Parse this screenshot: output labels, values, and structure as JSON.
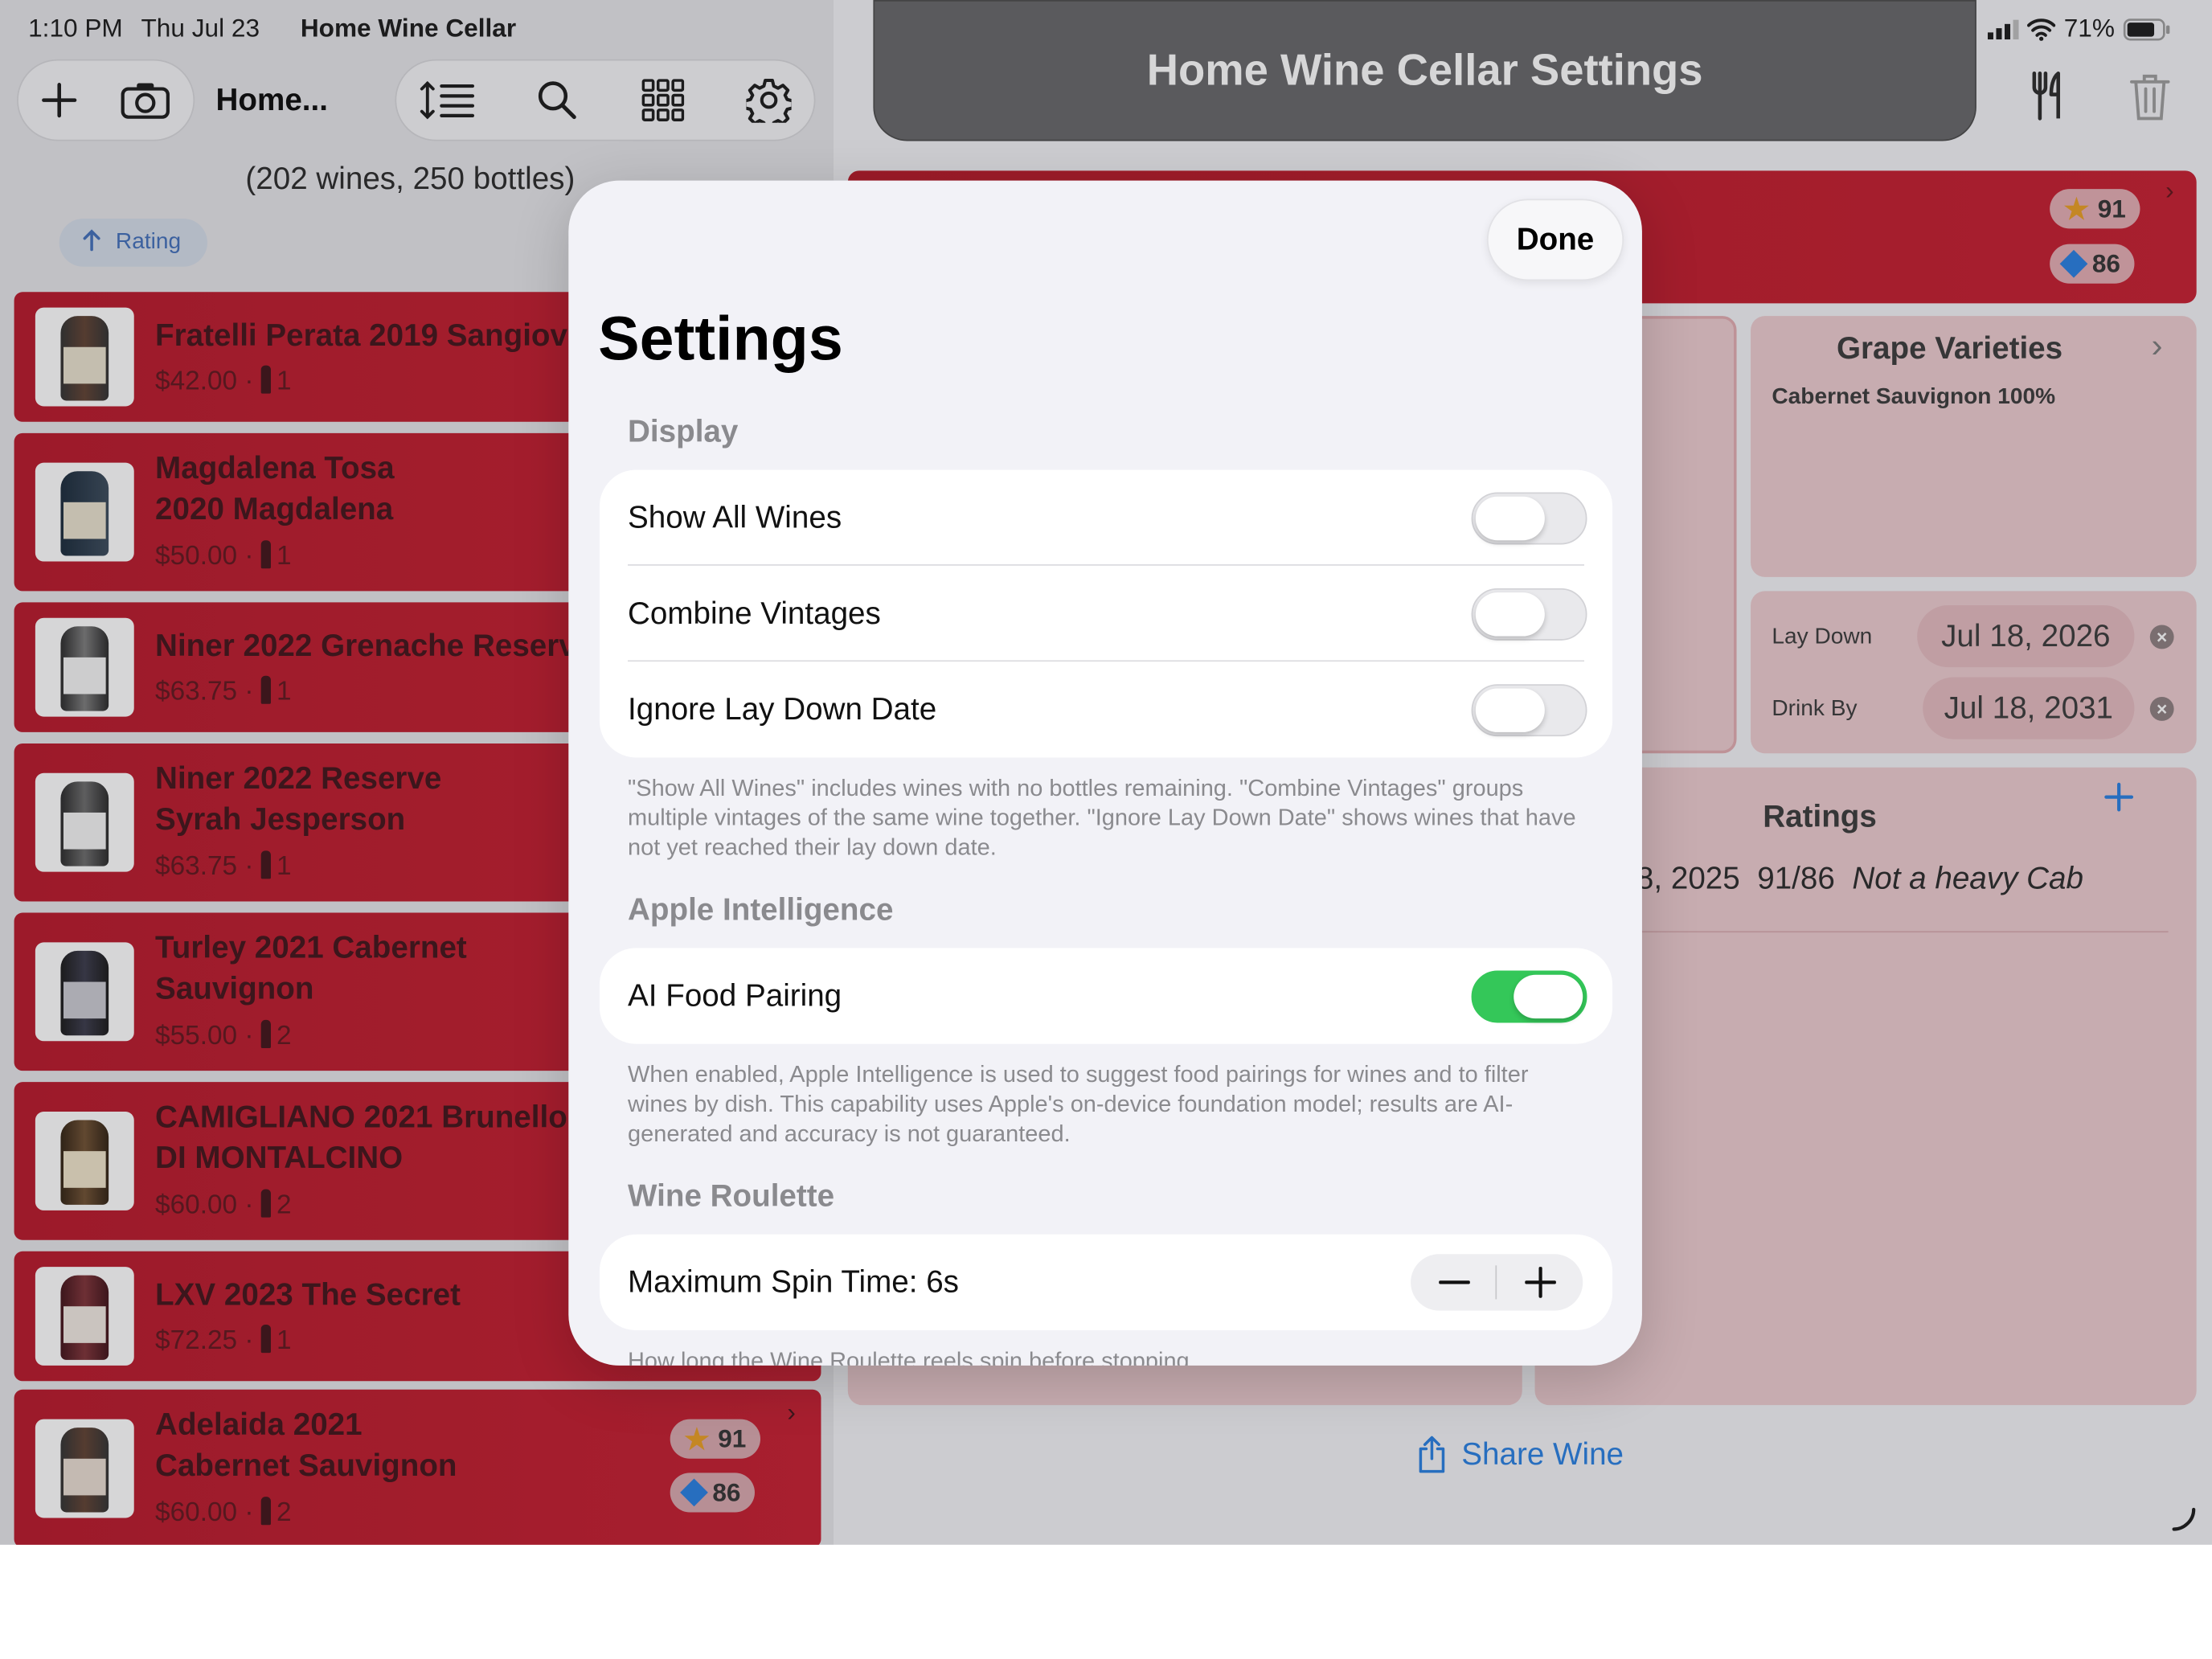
{
  "status_bar": {
    "time": "1:10 PM",
    "date": "Thu Jul 23",
    "app_name": "Home Wine Cellar",
    "battery": "71%"
  },
  "left_panel": {
    "toolbar_title": "Home...",
    "counts": "(202 wines, 250 bottles)",
    "sort_label": "Rating",
    "wines": [
      {
        "line1": "Fratelli Perata 2019 Sangiove",
        "line2": "",
        "price": "$42.00",
        "bottles": "1"
      },
      {
        "line1": "Magdalena Tosa",
        "line2": "2020 Magdalena",
        "price": "$50.00",
        "bottles": "1"
      },
      {
        "line1": "Niner 2022 Grenache Reserv",
        "line2": "",
        "price": "$63.75",
        "bottles": "1"
      },
      {
        "line1": "Niner 2022 Reserve",
        "line2": "Syrah Jesperson",
        "price": "$63.75",
        "bottles": "1"
      },
      {
        "line1": "Turley 2021 Cabernet",
        "line2": "Sauvignon",
        "price": "$55.00",
        "bottles": "2"
      },
      {
        "line1": "CAMIGLIANO 2021 Brunello",
        "line2": "DI MONTALCINO",
        "price": "$60.00",
        "bottles": "2"
      },
      {
        "line1": "LXV 2023 The Secret",
        "line2": "",
        "price": "$72.25",
        "bottles": "1"
      },
      {
        "line1": "Adelaida 2021",
        "line2": "Cabernet Sauvignon",
        "price": "$60.00",
        "bottles": "2",
        "rating_star": "91",
        "rating_diamond": "86"
      }
    ]
  },
  "right_panel": {
    "header_title": "Home Wine Cellar Settings",
    "top_badges": {
      "star": "91",
      "diamond": "86"
    },
    "grape_title": "Grape Varieties",
    "grape_value": "Cabernet Sauvignon 100%",
    "lay_down_label": "Lay Down",
    "lay_down_date": "Jul 18, 2026",
    "drink_by_label": "Drink By",
    "drink_by_date": "Jul 18, 2031",
    "ratings_title": "Ratings",
    "rating_entry_date": "8, 2025",
    "rating_entry_score": "91/86",
    "rating_entry_note": "Not a heavy Cab",
    "share_label": "Share Wine"
  },
  "settings": {
    "done_label": "Done",
    "title": "Settings",
    "display": {
      "header": "Display",
      "rows": [
        {
          "label": "Show All Wines",
          "on": false
        },
        {
          "label": "Combine Vintages",
          "on": false
        },
        {
          "label": "Ignore Lay Down Date",
          "on": false
        }
      ],
      "footer": "\"Show All Wines\" includes wines with no bottles remaining. \"Combine Vintages\" groups multiple vintages of the same wine together. \"Ignore Lay Down Date\" shows wines that have not yet reached their lay down date."
    },
    "ai": {
      "header": "Apple Intelligence",
      "row_label": "AI Food Pairing",
      "on": true,
      "footer": "When enabled, Apple Intelligence is used to suggest food pairings for wines and to filter wines by dish. This capability uses Apple's on-device foundation model; results are AI-generated and accuracy is not guaranteed."
    },
    "roulette": {
      "header": "Wine Roulette",
      "row_label": "Maximum Spin Time: 6s",
      "footer": "How long the Wine Roulette reels spin before stopping."
    }
  },
  "colors": {
    "wine_red": "#c41528",
    "toggle_on": "#34c759",
    "link_blue": "#1f7ae0"
  }
}
